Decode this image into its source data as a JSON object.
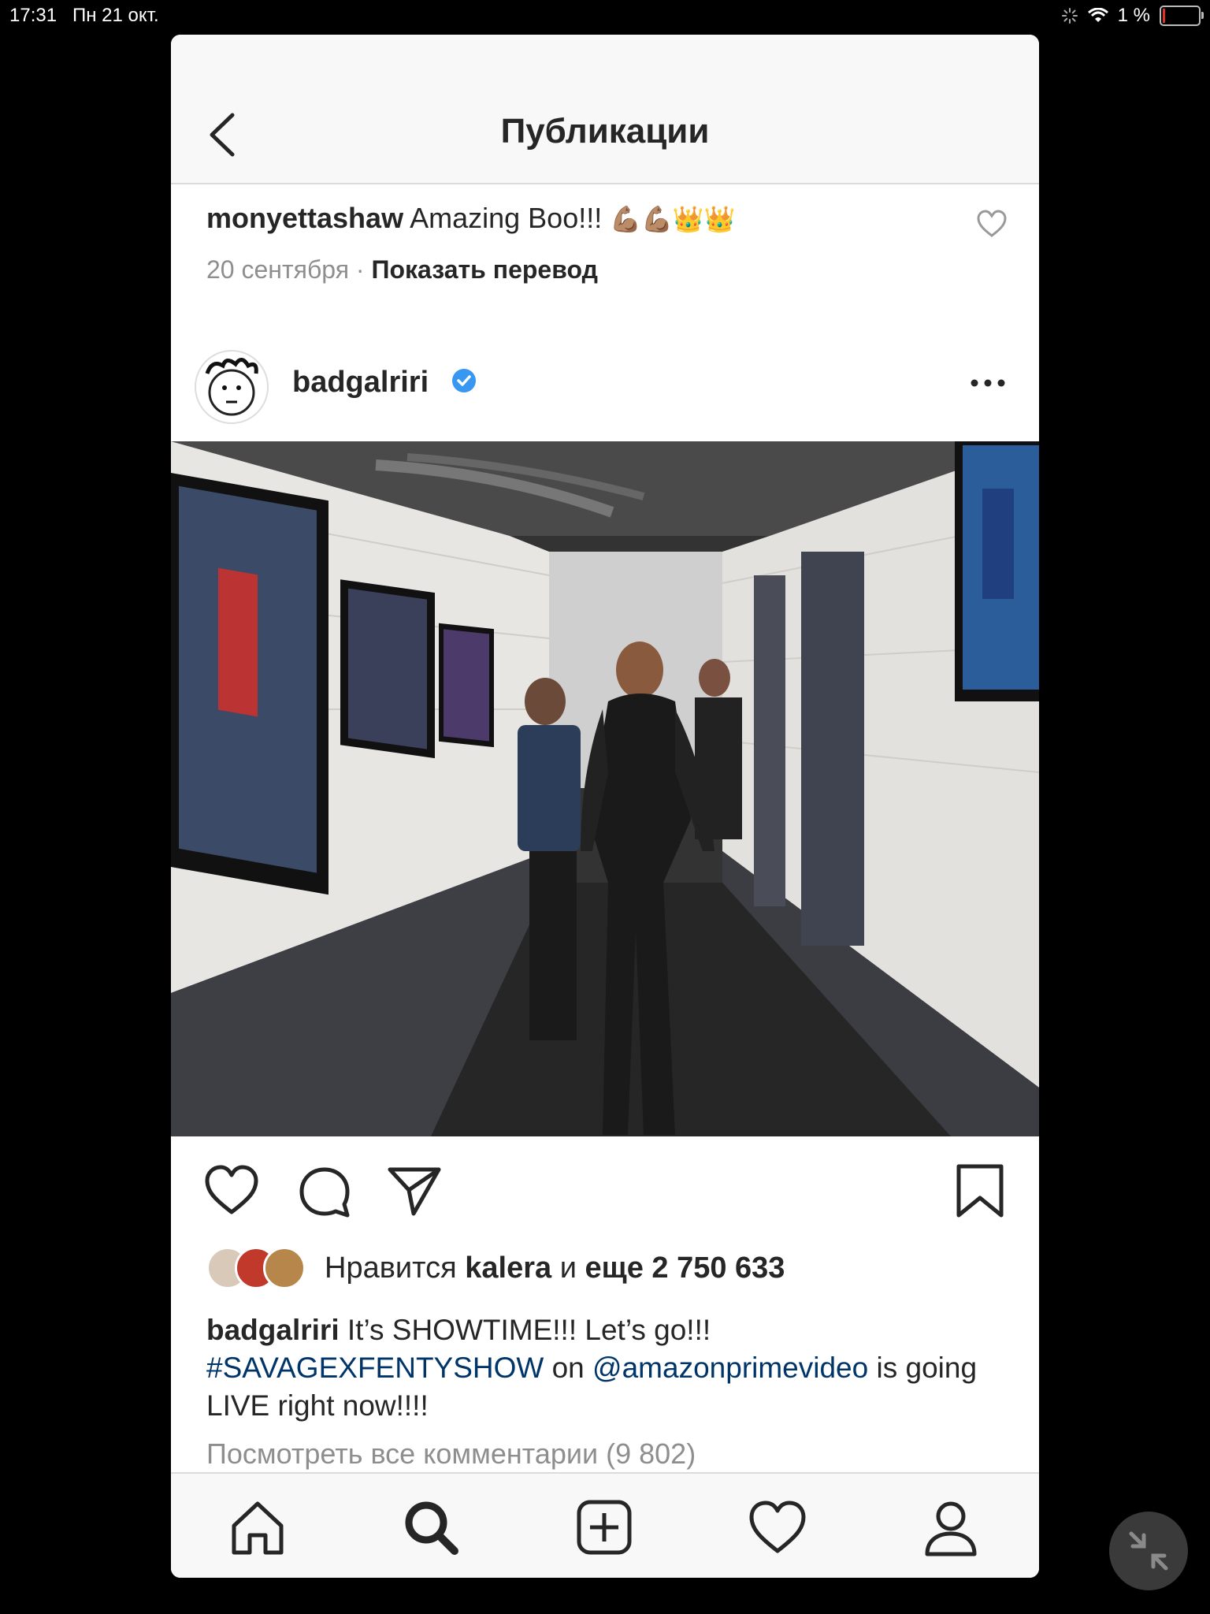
{
  "status_bar": {
    "time": "17:31",
    "date": "Пн 21 окт.",
    "battery": "1 %"
  },
  "nav": {
    "title": "Публикации"
  },
  "comment": {
    "username": "monyettashaw",
    "text": "Amazing Boo!!!",
    "emoji": "💪🏽💪🏽👑👑",
    "date": "20 сентября",
    "separator": "·",
    "translate": "Показать перевод"
  },
  "post": {
    "username": "badgalriri",
    "likes_prefix": "Нравится",
    "likes_user": "kalera",
    "likes_and": "и",
    "likes_count": "еще 2 750 633",
    "caption_user": "badgalriri",
    "caption_text1": "It’s SHOWTIME!!! Let’s go!!!",
    "caption_hashtag": "#SAVAGEXFENTYSHOW",
    "caption_on": "on",
    "caption_mention": "@amazonprimevideo",
    "caption_text2": "is going LIVE right now!!!!",
    "view_comments": "Посмотреть все комментарии (9 802)"
  },
  "icons": {
    "back": "chevron-left-icon",
    "like": "heart-icon",
    "comment": "comment-icon",
    "share": "paper-plane-icon",
    "save": "bookmark-icon",
    "more": "more-dots-icon",
    "home": "home-icon",
    "search": "search-icon",
    "add": "add-post-icon",
    "activity": "heart-icon",
    "profile": "profile-icon",
    "collapse": "collapse-icon"
  },
  "colors": {
    "link": "#003569",
    "verified": "#3897f0",
    "muted": "#8e8e8e"
  }
}
